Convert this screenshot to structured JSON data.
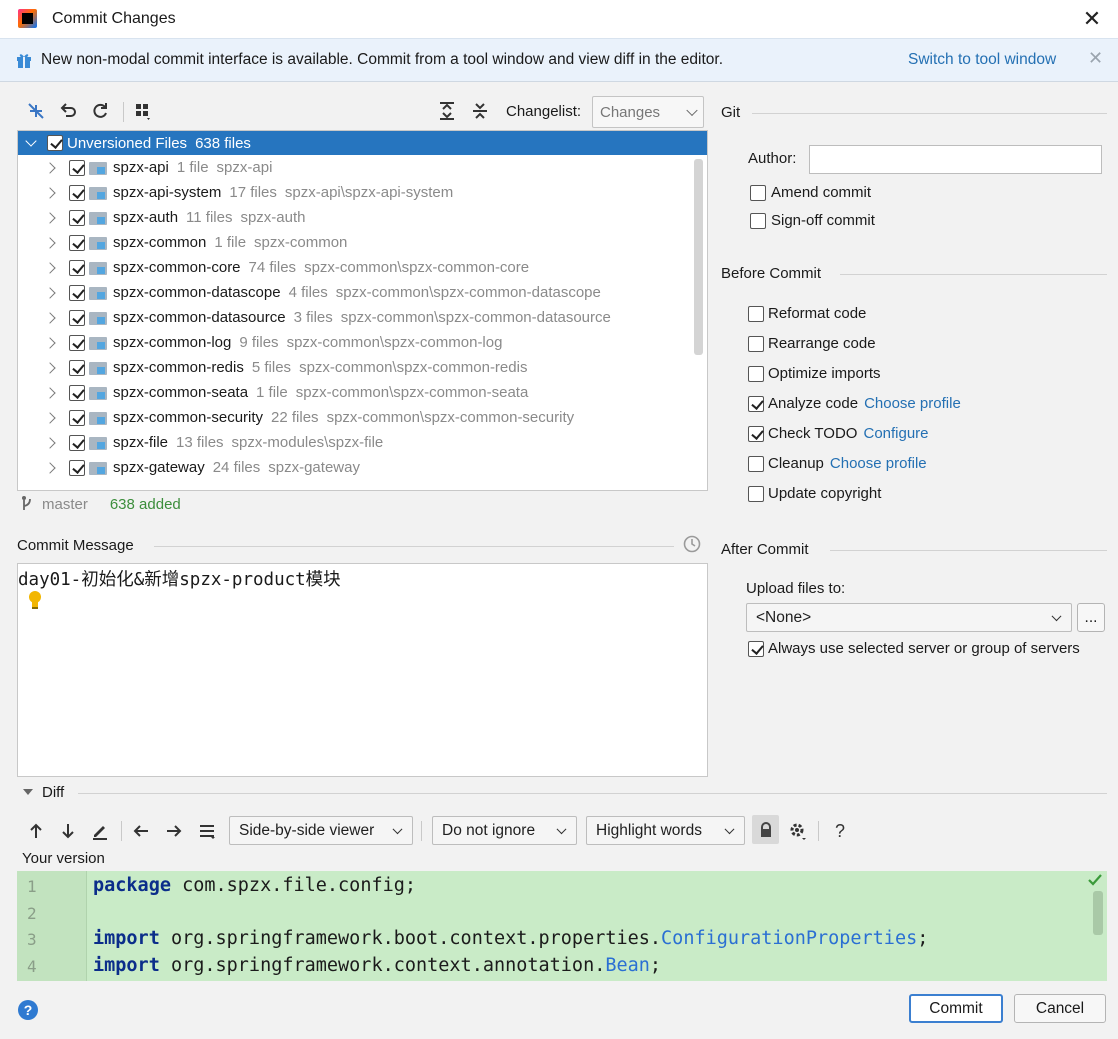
{
  "window": {
    "title": "Commit Changes"
  },
  "banner": {
    "text": "New non-modal commit interface is available. Commit from a tool window and view diff in the editor.",
    "link": "Switch to tool window"
  },
  "changes": {
    "changelist_label": "Changelist:",
    "changelist_value": "Changes",
    "root": {
      "label": "Unversioned Files",
      "count": "638 files"
    },
    "items": [
      {
        "name": "spzx-api",
        "count": "1 file",
        "path": "spzx-api"
      },
      {
        "name": "spzx-api-system",
        "count": "17 files",
        "path": "spzx-api\\spzx-api-system"
      },
      {
        "name": "spzx-auth",
        "count": "11 files",
        "path": "spzx-auth"
      },
      {
        "name": "spzx-common",
        "count": "1 file",
        "path": "spzx-common"
      },
      {
        "name": "spzx-common-core",
        "count": "74 files",
        "path": "spzx-common\\spzx-common-core"
      },
      {
        "name": "spzx-common-datascope",
        "count": "4 files",
        "path": "spzx-common\\spzx-common-datascope"
      },
      {
        "name": "spzx-common-datasource",
        "count": "3 files",
        "path": "spzx-common\\spzx-common-datasource"
      },
      {
        "name": "spzx-common-log",
        "count": "9 files",
        "path": "spzx-common\\spzx-common-log"
      },
      {
        "name": "spzx-common-redis",
        "count": "5 files",
        "path": "spzx-common\\spzx-common-redis"
      },
      {
        "name": "spzx-common-seata",
        "count": "1 file",
        "path": "spzx-common\\spzx-common-seata"
      },
      {
        "name": "spzx-common-security",
        "count": "22 files",
        "path": "spzx-common\\spzx-common-security"
      },
      {
        "name": "spzx-file",
        "count": "13 files",
        "path": "spzx-modules\\spzx-file"
      },
      {
        "name": "spzx-gateway",
        "count": "24 files",
        "path": "spzx-gateway"
      }
    ],
    "branch": "master",
    "added": "638 added"
  },
  "commit_message": {
    "label": "Commit Message",
    "text": "day01-初始化&新增spzx-product模块"
  },
  "git": {
    "title": "Git",
    "author_label": "Author:",
    "author_value": "",
    "amend": "Amend commit",
    "signoff": "Sign-off commit"
  },
  "before_commit": {
    "title": "Before Commit",
    "options": [
      {
        "label": "Reformat code",
        "checked": false,
        "link": ""
      },
      {
        "label": "Rearrange code",
        "checked": false,
        "link": ""
      },
      {
        "label": "Optimize imports",
        "checked": false,
        "link": ""
      },
      {
        "label": "Analyze code",
        "checked": true,
        "link": "Choose profile"
      },
      {
        "label": "Check TODO",
        "checked": true,
        "link": "Configure"
      },
      {
        "label": "Cleanup",
        "checked": false,
        "link": "Choose profile"
      },
      {
        "label": "Update copyright",
        "checked": false,
        "link": ""
      }
    ]
  },
  "after_commit": {
    "title": "After Commit",
    "upload_label": "Upload files to:",
    "upload_value": "<None>",
    "more_button": "...",
    "always_use": "Always use selected server or group of servers"
  },
  "diff": {
    "title": "Diff",
    "viewer": "Side-by-side viewer",
    "ignore": "Do not ignore",
    "highlight": "Highlight words",
    "help": "?",
    "version_label": "Your version",
    "lines": [
      {
        "no": "1",
        "kw": "package",
        "rest": " com.spzx.file.config;",
        "cls": "",
        "tail": ""
      },
      {
        "no": "2",
        "kw": "",
        "rest": "",
        "cls": "",
        "tail": ""
      },
      {
        "no": "3",
        "kw": "import",
        "rest": " org.springframework.boot.context.properties.",
        "cls": "ConfigurationProperties",
        "tail": ";"
      },
      {
        "no": "4",
        "kw": "import",
        "rest": " org.springframework.context.annotation.",
        "cls": "Bean",
        "tail": ";"
      }
    ]
  },
  "buttons": {
    "commit": "Commit",
    "cancel": "Cancel",
    "help": "?"
  }
}
